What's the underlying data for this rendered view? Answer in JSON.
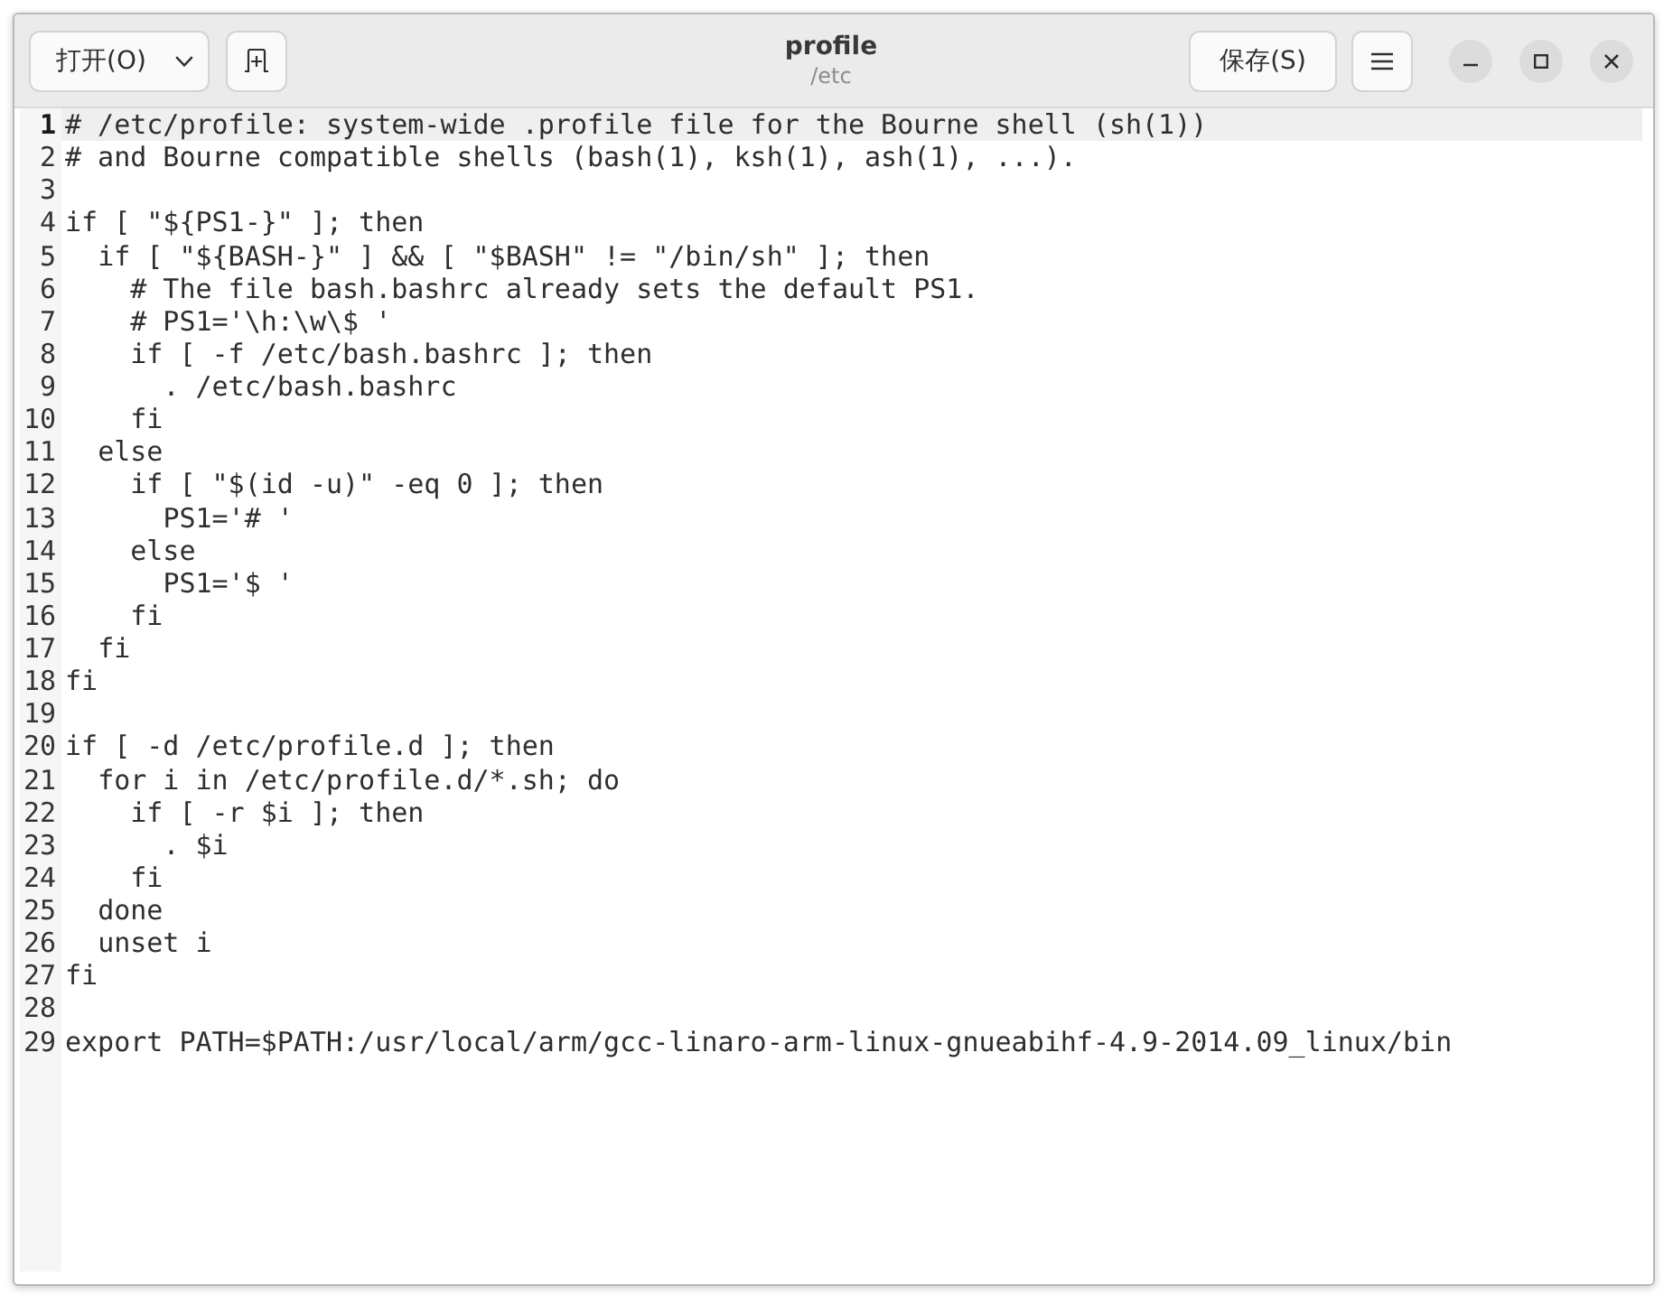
{
  "window": {
    "title": "profile",
    "path": "/etc"
  },
  "header_bar": {
    "open_button": "打开(O)",
    "save_button": "保存(S)"
  },
  "editor": {
    "lines": [
      {
        "number": "1",
        "text": "# /etc/profile: system-wide .profile file for the Bourne shell (sh(1))",
        "current": true
      },
      {
        "number": "2",
        "text": "# and Bourne compatible shells (bash(1), ksh(1), ash(1), ...).",
        "current": false
      },
      {
        "number": "3",
        "current": false
      },
      {
        "number": "4",
        "text": "if [ \"${PS1-}\" ]; then",
        "current": false
      },
      {
        "number": "5",
        "text": "  if [ \"${BASH-}\" ] && [ \"$BASH\" != \"/bin/sh\" ]; then",
        "current": false
      },
      {
        "number": "6",
        "text": "    # The file bash.bashrc already sets the default PS1.",
        "current": false
      },
      {
        "number": "7",
        "text": "    # PS1='\\h:\\w\\$ '",
        "current": false
      },
      {
        "number": "8",
        "text": "    if [ -f /etc/bash.bashrc ]; then",
        "current": false
      },
      {
        "number": "9",
        "text": "      . /etc/bash.bashrc",
        "current": false
      },
      {
        "number": "10",
        "text": "    fi",
        "current": false
      },
      {
        "number": "11",
        "text": "  else",
        "current": false
      },
      {
        "number": "12",
        "text": "    if [ \"$(id -u)\" -eq 0 ]; then",
        "current": false
      },
      {
        "number": "13",
        "text": "      PS1='# '",
        "current": false
      },
      {
        "number": "14",
        "text": "    else",
        "current": false
      },
      {
        "number": "15",
        "text": "      PS1='$ '",
        "current": false
      },
      {
        "number": "16",
        "text": "    fi",
        "current": false
      },
      {
        "number": "17",
        "text": "  fi",
        "current": false
      },
      {
        "number": "18",
        "text": "fi",
        "current": false
      },
      {
        "number": "19",
        "current": false
      },
      {
        "number": "20",
        "text": "if [ -d /etc/profile.d ]; then",
        "current": false
      },
      {
        "number": "21",
        "text": "  for i in /etc/profile.d/*.sh; do",
        "current": false
      },
      {
        "number": "22",
        "text": "    if [ -r $i ]; then",
        "current": false
      },
      {
        "number": "23",
        "text": "      . $i",
        "current": false
      },
      {
        "number": "24",
        "text": "    fi",
        "current": false
      },
      {
        "number": "25",
        "text": "  done",
        "current": false
      },
      {
        "number": "26",
        "text": "  unset i",
        "current": false
      },
      {
        "number": "27",
        "text": "fi",
        "current": false
      },
      {
        "number": "28",
        "current": false
      },
      {
        "number": "29",
        "text": "export PATH=$PATH:/usr/local/arm/gcc-linaro-arm-linux-gnueabihf-4.9-2014.09_linux/bin",
        "current": false
      }
    ]
  }
}
